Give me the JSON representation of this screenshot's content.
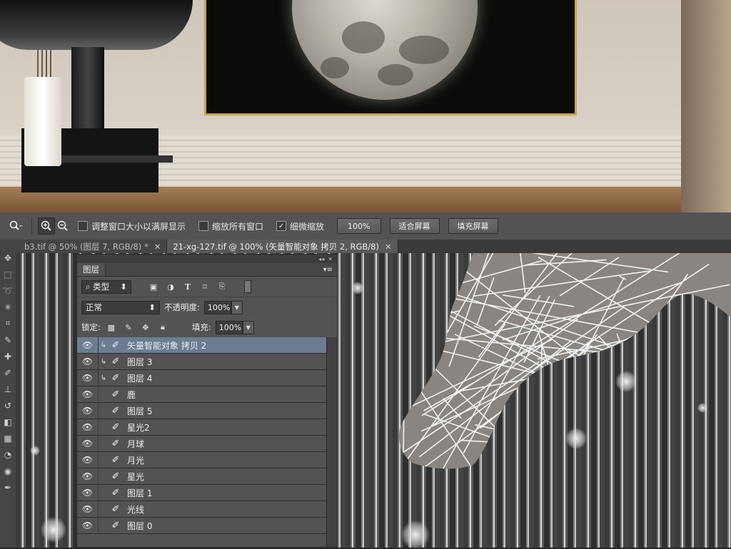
{
  "options_bar": {
    "checkbox_resize": "调整窗口大小以满屏显示",
    "checkbox_zoom_all": "缩放所有窗口",
    "checkbox_scrubby": "细微缩放",
    "btn_100": "100%",
    "btn_fit": "适合屏幕",
    "btn_fill": "填充屏幕"
  },
  "tabs": [
    {
      "label": "b3.tif @ 50% (图层 7, RGB/8) *",
      "active": false
    },
    {
      "label": "21-xg-127.tif @ 100% (矢量智能对象 拷贝 2, RGB/8)",
      "active": true
    }
  ],
  "layers_panel": {
    "title": "图层",
    "filter_label": "类型",
    "blend_mode": "正常",
    "opacity_label": "不透明度:",
    "opacity_value": "100%",
    "lock_label": "锁定:",
    "fill_label": "填充:",
    "fill_value": "100%",
    "layers": [
      {
        "name": "矢量智能对象 拷贝 2",
        "clipped": true,
        "selected": true
      },
      {
        "name": "图层 3",
        "clipped": true,
        "selected": false
      },
      {
        "name": "图层 4",
        "clipped": true,
        "selected": false
      },
      {
        "name": "鹿",
        "clipped": false,
        "selected": false
      },
      {
        "name": "图层 5",
        "clipped": false,
        "selected": false
      },
      {
        "name": "星光2",
        "clipped": false,
        "selected": false
      },
      {
        "name": "月球",
        "clipped": false,
        "selected": false
      },
      {
        "name": "月光",
        "clipped": false,
        "selected": false
      },
      {
        "name": "星光",
        "clipped": false,
        "selected": false
      },
      {
        "name": "图层 1",
        "clipped": false,
        "selected": false
      },
      {
        "name": "光线",
        "clipped": false,
        "selected": false
      },
      {
        "name": "图层 0",
        "clipped": false,
        "selected": false
      }
    ]
  },
  "colors": {
    "selected_layer": "#6c7d92",
    "panel_bg": "#535353",
    "frame_gold": "#c8a64c"
  }
}
